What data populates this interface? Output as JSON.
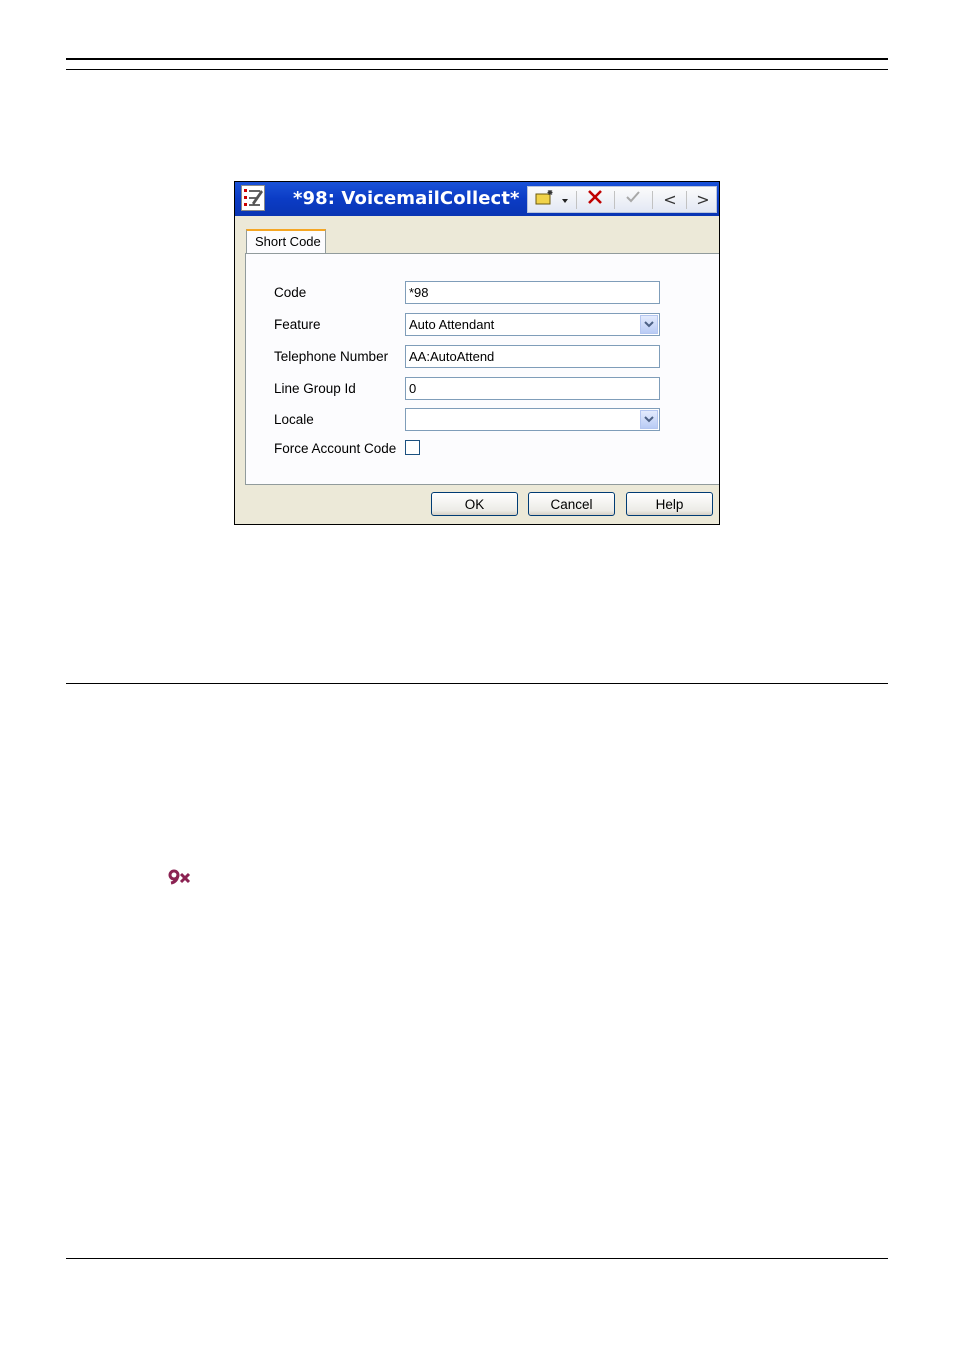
{
  "dialog": {
    "title": "*98: VoicemailCollect*",
    "toolbar": {
      "add_icon": "add-record-icon",
      "dropdown_icon": "caret-down-icon",
      "delete_icon": "delete-x-icon",
      "validate_icon": "checkmark-icon",
      "prev_label": "<",
      "next_label": ">"
    },
    "tab_label": "Short Code",
    "fields": {
      "code": {
        "label": "Code",
        "value": "*98"
      },
      "feature": {
        "label": "Feature",
        "value": "Auto Attendant"
      },
      "telephone_number": {
        "label": "Telephone Number",
        "value": "AA:AutoAttend"
      },
      "line_group_id": {
        "label": "Line Group Id",
        "value": "0"
      },
      "locale": {
        "label": "Locale",
        "value": ""
      },
      "force_account_code": {
        "label": "Force Account Code",
        "checked": false
      }
    },
    "buttons": {
      "ok": "OK",
      "cancel": "Cancel",
      "help": "Help"
    }
  },
  "colors": {
    "title_bar": "#0b3cc5",
    "tab_highlight": "#f5a623",
    "delete_red": "#c00000"
  }
}
